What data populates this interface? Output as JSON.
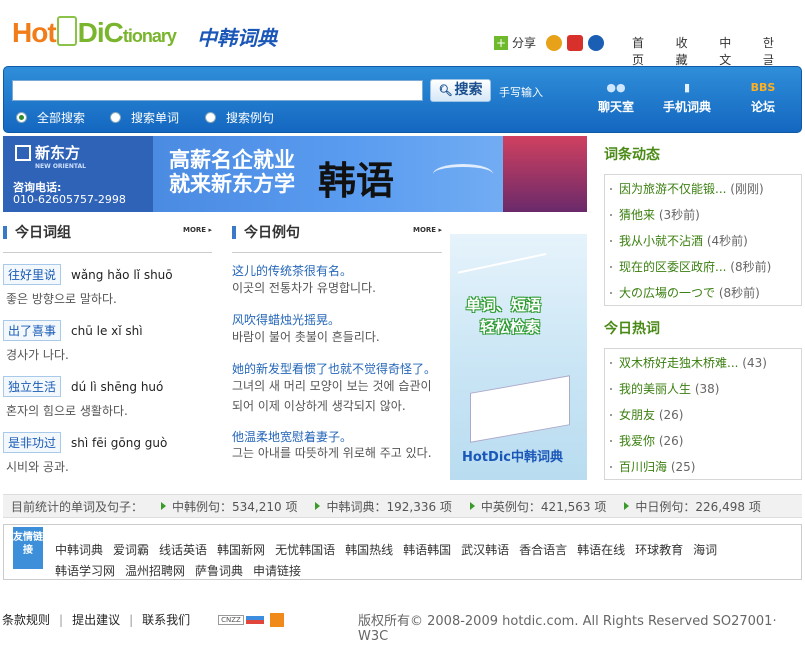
{
  "header": {
    "logo": {
      "hot": "Hot",
      "di": "Di",
      "c": "C",
      "tionary": "tionary"
    },
    "logo_cn": "中韩词典",
    "share": "分享",
    "nav": [
      "首页",
      "收藏",
      "中文",
      "한글"
    ]
  },
  "search": {
    "input_value": "",
    "button": "搜索",
    "handwrite": "手写输入",
    "options": [
      "全部搜索",
      "搜索单词",
      "搜索例句"
    ],
    "selected": 0,
    "quick_links": [
      "聊天室",
      "手机词典",
      "论坛"
    ],
    "quick_icons": [
      "chat-icon",
      "phone-icon",
      "bbs-icon"
    ],
    "bbs_icon_text": "BBS"
  },
  "banner": {
    "brand": "新东方",
    "brand_en": "NEW ORIENTAL",
    "phone_label": "咨询电话:",
    "phone": "010-62605757-2998",
    "line1": "高薪名企就业",
    "line2": "就来新东方学",
    "big": "韩语"
  },
  "phrases": {
    "title": "今日词组",
    "more": "MORE",
    "items": [
      {
        "cn": "往好里说",
        "py": "wǎng hǎo lǐ shuō",
        "ko": "좋은 방향으로 말하다."
      },
      {
        "cn": "出了喜事",
        "py": "chū le xǐ shì",
        "ko": "경사가 나다."
      },
      {
        "cn": "独立生活",
        "py": "dú lì shēng huó",
        "ko": "혼자의 힘으로 생활하다."
      },
      {
        "cn": "是非功过",
        "py": "shì fēi gōng guò",
        "ko": "시비와 공과."
      }
    ]
  },
  "examples": {
    "title": "今日例句",
    "more": "MORE",
    "items": [
      {
        "cn": "这儿的传统茶很有名。",
        "ko": "이곳의 전통차가 유명합니다."
      },
      {
        "cn": "风吹得蜡烛光摇晃。",
        "ko": "바람이 불어 촛불이 흔들리다."
      },
      {
        "cn": "她的新发型看惯了也就不觉得奇怪了。",
        "ko": "그녀의 새 머리 모양이 보는 것에 습관이 되어 이제 이상하게 생각되지 않아."
      },
      {
        "cn": "他温柔地宽慰着妻子。",
        "ko": "그는 아내를 따뜻하게 위로해 주고 있다."
      }
    ]
  },
  "promo": {
    "line1": "单词、短语",
    "line2": "轻松检索",
    "brand": "HotDic中韩词典"
  },
  "dynamics": {
    "title": "词条动态",
    "items": [
      {
        "text": "因为旅游不仅能锻...",
        "time": "(刚刚)"
      },
      {
        "text": "猜他来",
        "time": "(3秒前)"
      },
      {
        "text": "我从小就不沾酒",
        "time": "(4秒前)"
      },
      {
        "text": "现在的区委区政府...",
        "time": "(8秒前)"
      },
      {
        "text": "大の広場の一つで",
        "time": "(8秒前)"
      }
    ]
  },
  "hot": {
    "title": "今日热词",
    "items": [
      {
        "text": "双木桥好走独木桥难...",
        "count": "(43)"
      },
      {
        "text": "我的美丽人生",
        "count": "(38)"
      },
      {
        "text": "女朋友",
        "count": "(26)"
      },
      {
        "text": "我爱你",
        "count": "(26)"
      },
      {
        "text": "百川归海",
        "count": "(25)"
      }
    ]
  },
  "stats": {
    "label": "目前统计的单词及句子：",
    "items": [
      "中韩例句：534,210 项",
      "中韩词典：192,336 项",
      "中英例句：421,563 项",
      "中日例句：226,498 项"
    ]
  },
  "links": {
    "label": "友情链接",
    "items": [
      "中韩词典",
      "爱词霸",
      "线话英语",
      "韩国新网",
      "无忧韩国语",
      "韩国热线",
      "韩语韩国",
      "武汉韩语",
      "香合语言",
      "韩语在线",
      "环球教育",
      "海词",
      "韩语学习网",
      "温州招聘网",
      "萨鲁词典",
      "申请链接"
    ]
  },
  "footer": {
    "links": [
      "条款规则",
      "提出建议",
      "联系我们"
    ],
    "cnzz": "CNZZ",
    "copyright": "版权所有© 2008-2009 hotdic.com. All Rights Reserved SO27001· W3C"
  }
}
